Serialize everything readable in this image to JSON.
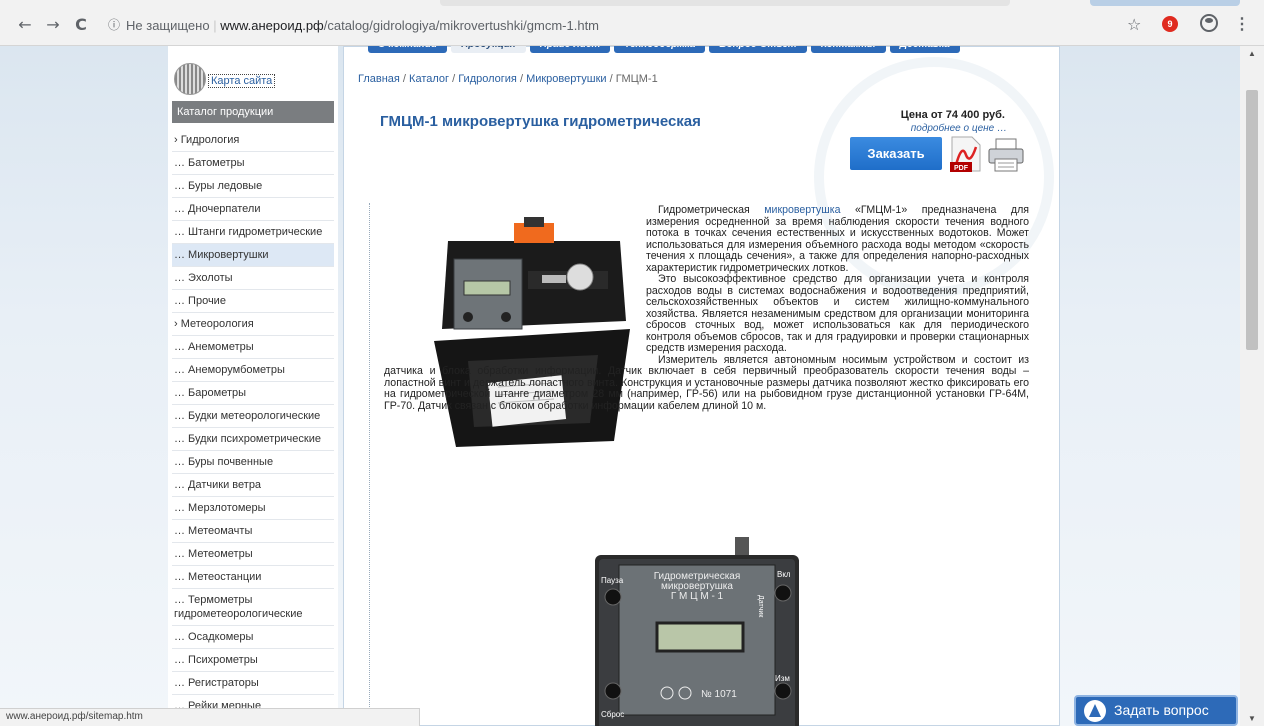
{
  "browser": {
    "back_icon": "←",
    "forward_icon": "→",
    "reload_icon": "C",
    "info_icon": "ⓘ",
    "security_label": "Не защищено",
    "url_domain": "www.анероид.рф",
    "url_path": "/catalog/gidrologiya/mikrovertushki/gmcm-1.htm",
    "star_icon": "☆",
    "extension_badge": "9",
    "menu_icon": "⋮",
    "status_url": "www.анероид.рф/sitemap.htm"
  },
  "site": {
    "sitemap_label": "Карта сайта",
    "topnav": [
      "О компании",
      "Продукция",
      "Прайс-лист",
      "Техподдержка",
      "Вопрос-Ответ",
      "Контакты",
      "Доставка"
    ],
    "active_nav_index": 1,
    "catalog_header": "Каталог продукции",
    "catalog": [
      "› Гидрология",
      "… Батометры",
      "… Буры ледовые",
      "… Дночерпатели",
      "… Штанги гидрометрические",
      "… Микровертушки",
      "… Эхолоты",
      "… Прочие",
      "› Метеорология",
      "… Анемометры",
      "… Анеморумбометры",
      "… Барометры",
      "… Будки метеорологические",
      "… Будки психрометрические",
      "… Буры почвенные",
      "… Датчики ветра",
      "… Мерзлотомеры",
      "… Метеомачты",
      "… Метеометры",
      "… Метеостанции",
      "… Термометры гидрометеорологические",
      "… Осадкомеры",
      "… Психрометры",
      "… Регистраторы",
      "… Рейки мерные"
    ],
    "active_catalog_index": 5
  },
  "breadcrumb": {
    "items": [
      "Главная",
      "Каталог",
      "Гидрология",
      "Микровертушки"
    ],
    "current": "ГМЦМ-1",
    "separator": " / "
  },
  "product": {
    "title": "ГМЦМ-1 микровертушка гидрометрическая",
    "price": "Цена от 74 400 руб.",
    "price_more": "подробнее о цене …",
    "order_label": "Заказать",
    "pdf_label": "PDF",
    "p1_start": "Гидрометрическая ",
    "p1_link": "микровертушка",
    "p1_rest": " «ГМЦМ-1» предназначена для измерения осредненной за время наблюдения скорости течения водного потока в точках сечения естественных и искусственных водотоков. Может использоваться для измерения объемного расхода воды методом «скорость течения х площадь сечения», а также для определения напорно-расходных характеристик гидрометрических лотков.",
    "p2": "Это высокоэффективное средство для организации учета и контроля расходов воды в системах водоснабжения и водоотведения предприятий, сельскохозяйственных объектов и систем жилищно-коммунального хозяйства. Является незаменимым средством для организации мониторинга сбросов сточных вод, может использоваться как для периодического контроля объемов сбросов, так и для градуировки и проверки стационарных средств измерения расхода.",
    "p3": "Измеритель является автономным носимым устройством и состоит из датчика и блока обработки информации. Датчик включает в себя первичный преобразователь скорости течения воды – лопастной винт и держатель лопастного винта. Конструкция и установочные размеры датчика позволяют жестко фиксировать его на гидрометрической штанге диаметром 28 мм (например, ГР-56) или на рыбовидном грузе дистанционной установки ГР-64М, ГР-70. Датчик связан с блоком обработки информации кабелем длиной 10 м.",
    "device_label_1": "Гидрометрическая",
    "device_label_2": "микровертушка",
    "device_label_3": "Г М Ц М - 1",
    "device_serial": "№ 1071",
    "device_btn_pause": "Пауза",
    "device_btn_on": "Вкл",
    "device_btn_reset": "Сброс",
    "device_btn_meas": "Изм",
    "device_sensor_label": "Датчик"
  },
  "widget": {
    "ask_label": "Задать вопрос"
  },
  "colors": {
    "accent": "#2a5fa0",
    "nav_blue": "#2d6ab8",
    "catalog_header": "#7a7d80"
  }
}
